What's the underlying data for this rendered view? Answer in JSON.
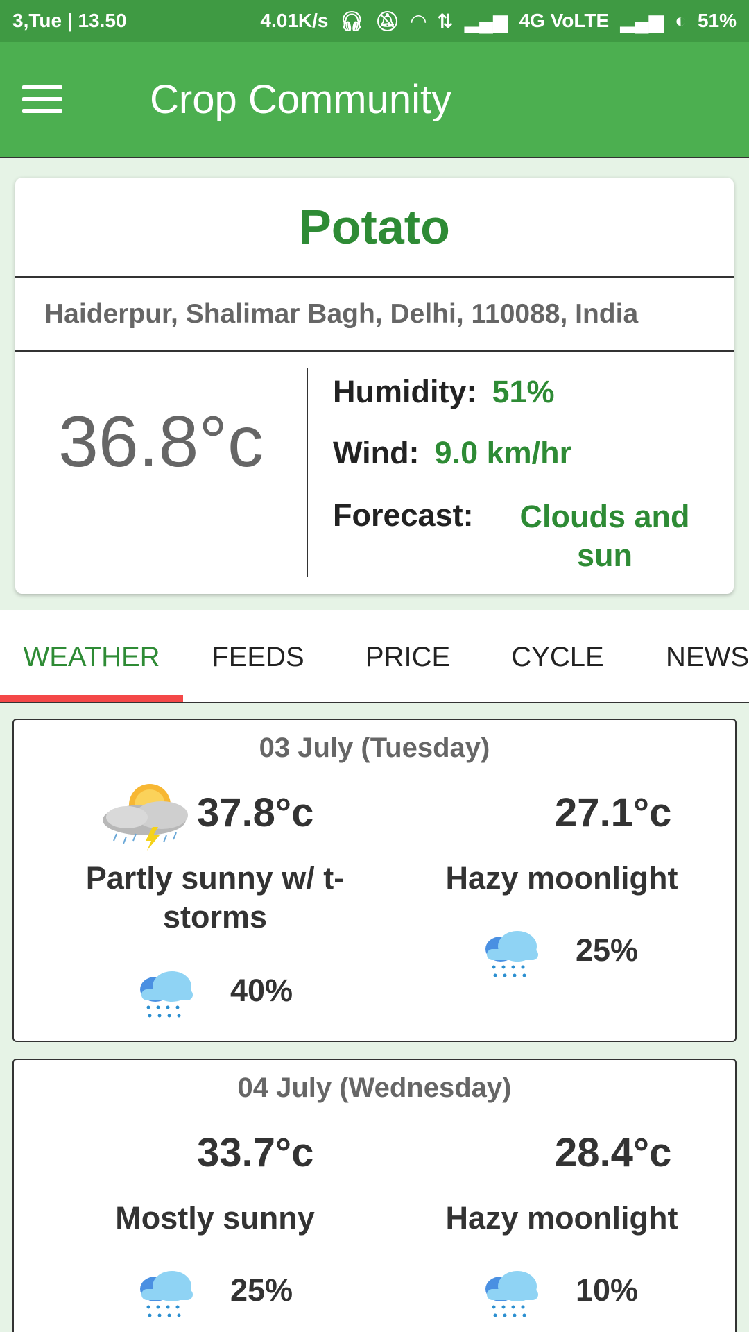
{
  "status_bar": {
    "left": "3,Tue | 13.50",
    "speed": "4.01K/s",
    "network": "4G VoLTE",
    "battery": "51%"
  },
  "app_bar": {
    "title": "Crop Community"
  },
  "crop": {
    "name": "Potato",
    "location": "Haiderpur, Shalimar Bagh, Delhi, 110088, India",
    "temperature": "36.8°c",
    "humidity_label": "Humidity:",
    "humidity_value": "51%",
    "wind_label": "Wind:",
    "wind_value": "9.0 km/hr",
    "forecast_label": "Forecast:",
    "forecast_value": "Clouds and sun"
  },
  "tabs": [
    {
      "label": "WEATHER",
      "active": true
    },
    {
      "label": "FEEDS",
      "active": false
    },
    {
      "label": "PRICE",
      "active": false
    },
    {
      "label": "CYCLE",
      "active": false
    },
    {
      "label": "NEWS",
      "active": false
    }
  ],
  "days": [
    {
      "date": "03 July (Tuesday)",
      "day_temp": "37.8°c",
      "day_condition": "Partly sunny w/ t-storms",
      "day_icon": "sun-cloud-thunder-icon",
      "day_rain": "40%",
      "night_temp": "27.1°c",
      "night_condition": "Hazy moonlight",
      "night_rain": "25%"
    },
    {
      "date": "04 July (Wednesday)",
      "day_temp": "33.7°c",
      "day_condition": "Mostly sunny",
      "day_rain": "25%",
      "night_temp": "28.4°c",
      "night_condition": "Hazy moonlight",
      "night_rain": "10%"
    }
  ],
  "colors": {
    "primary": "#4caf50",
    "status_bar": "#3f9a43",
    "accent_text": "#2e8b35",
    "tab_indicator": "#f44848"
  }
}
